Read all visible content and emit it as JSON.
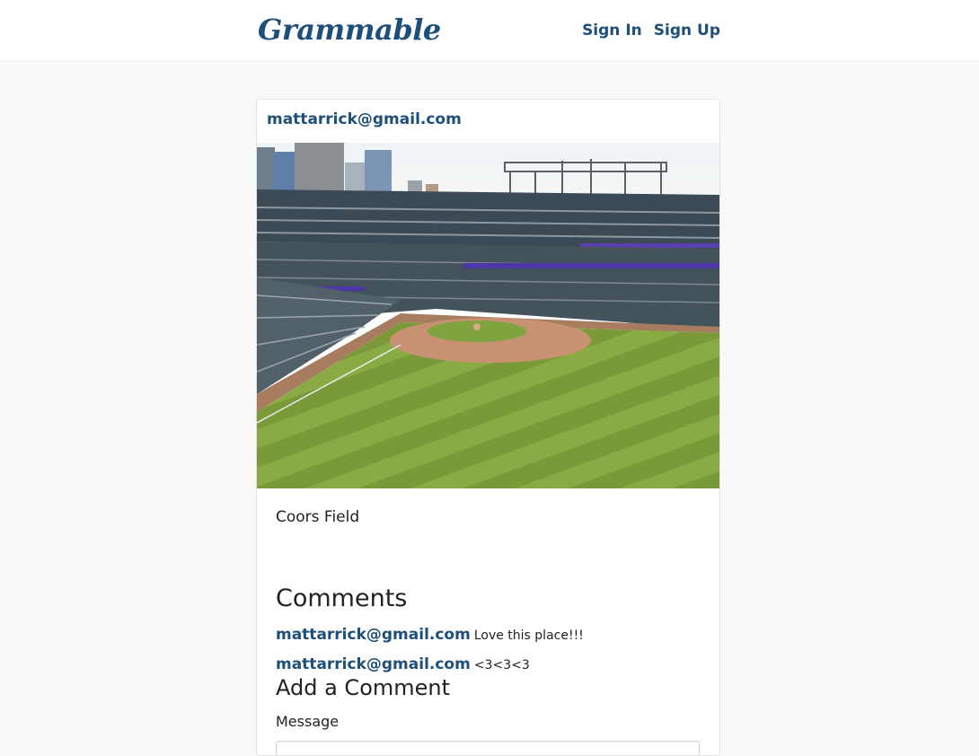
{
  "navbar": {
    "brand": "Grammable",
    "links": [
      {
        "label": "Sign In"
      },
      {
        "label": "Sign Up"
      }
    ]
  },
  "post": {
    "author": "mattarrick@gmail.com",
    "image": {
      "icon": "photo-baseball-stadium"
    },
    "caption": "Coors Field"
  },
  "comments": {
    "title": "Comments",
    "items": [
      {
        "author": "mattarrick@gmail.com",
        "text": "Love this place!!!"
      },
      {
        "author": "mattarrick@gmail.com",
        "text": "<3<3<3"
      }
    ]
  },
  "add_comment": {
    "title": "Add a Comment",
    "message_label": "Message",
    "message_value": ""
  },
  "colors": {
    "brand": "#1e4f7a",
    "background": "#f9f9f9",
    "card": "#ffffff"
  }
}
